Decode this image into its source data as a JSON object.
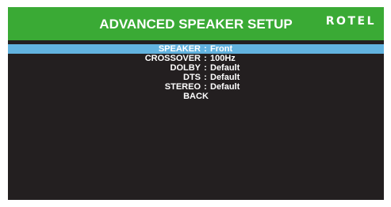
{
  "header": {
    "title": "ADVANCED SPEAKER SETUP",
    "logo": "ROTEL",
    "color": "#3aaa35"
  },
  "colors": {
    "background": "#231f20",
    "highlight": "#62b3df",
    "text": "#ffffff"
  },
  "menu": {
    "separator": ":",
    "items": [
      {
        "label": "SPEAKER",
        "value": "Front",
        "selected": true
      },
      {
        "label": "CROSSOVER",
        "value": "100Hz",
        "selected": false
      },
      {
        "label": "DOLBY",
        "value": "Default",
        "selected": false
      },
      {
        "label": "DTS",
        "value": "Default",
        "selected": false
      },
      {
        "label": "STEREO",
        "value": "Default",
        "selected": false
      }
    ],
    "back_label": "BACK"
  }
}
